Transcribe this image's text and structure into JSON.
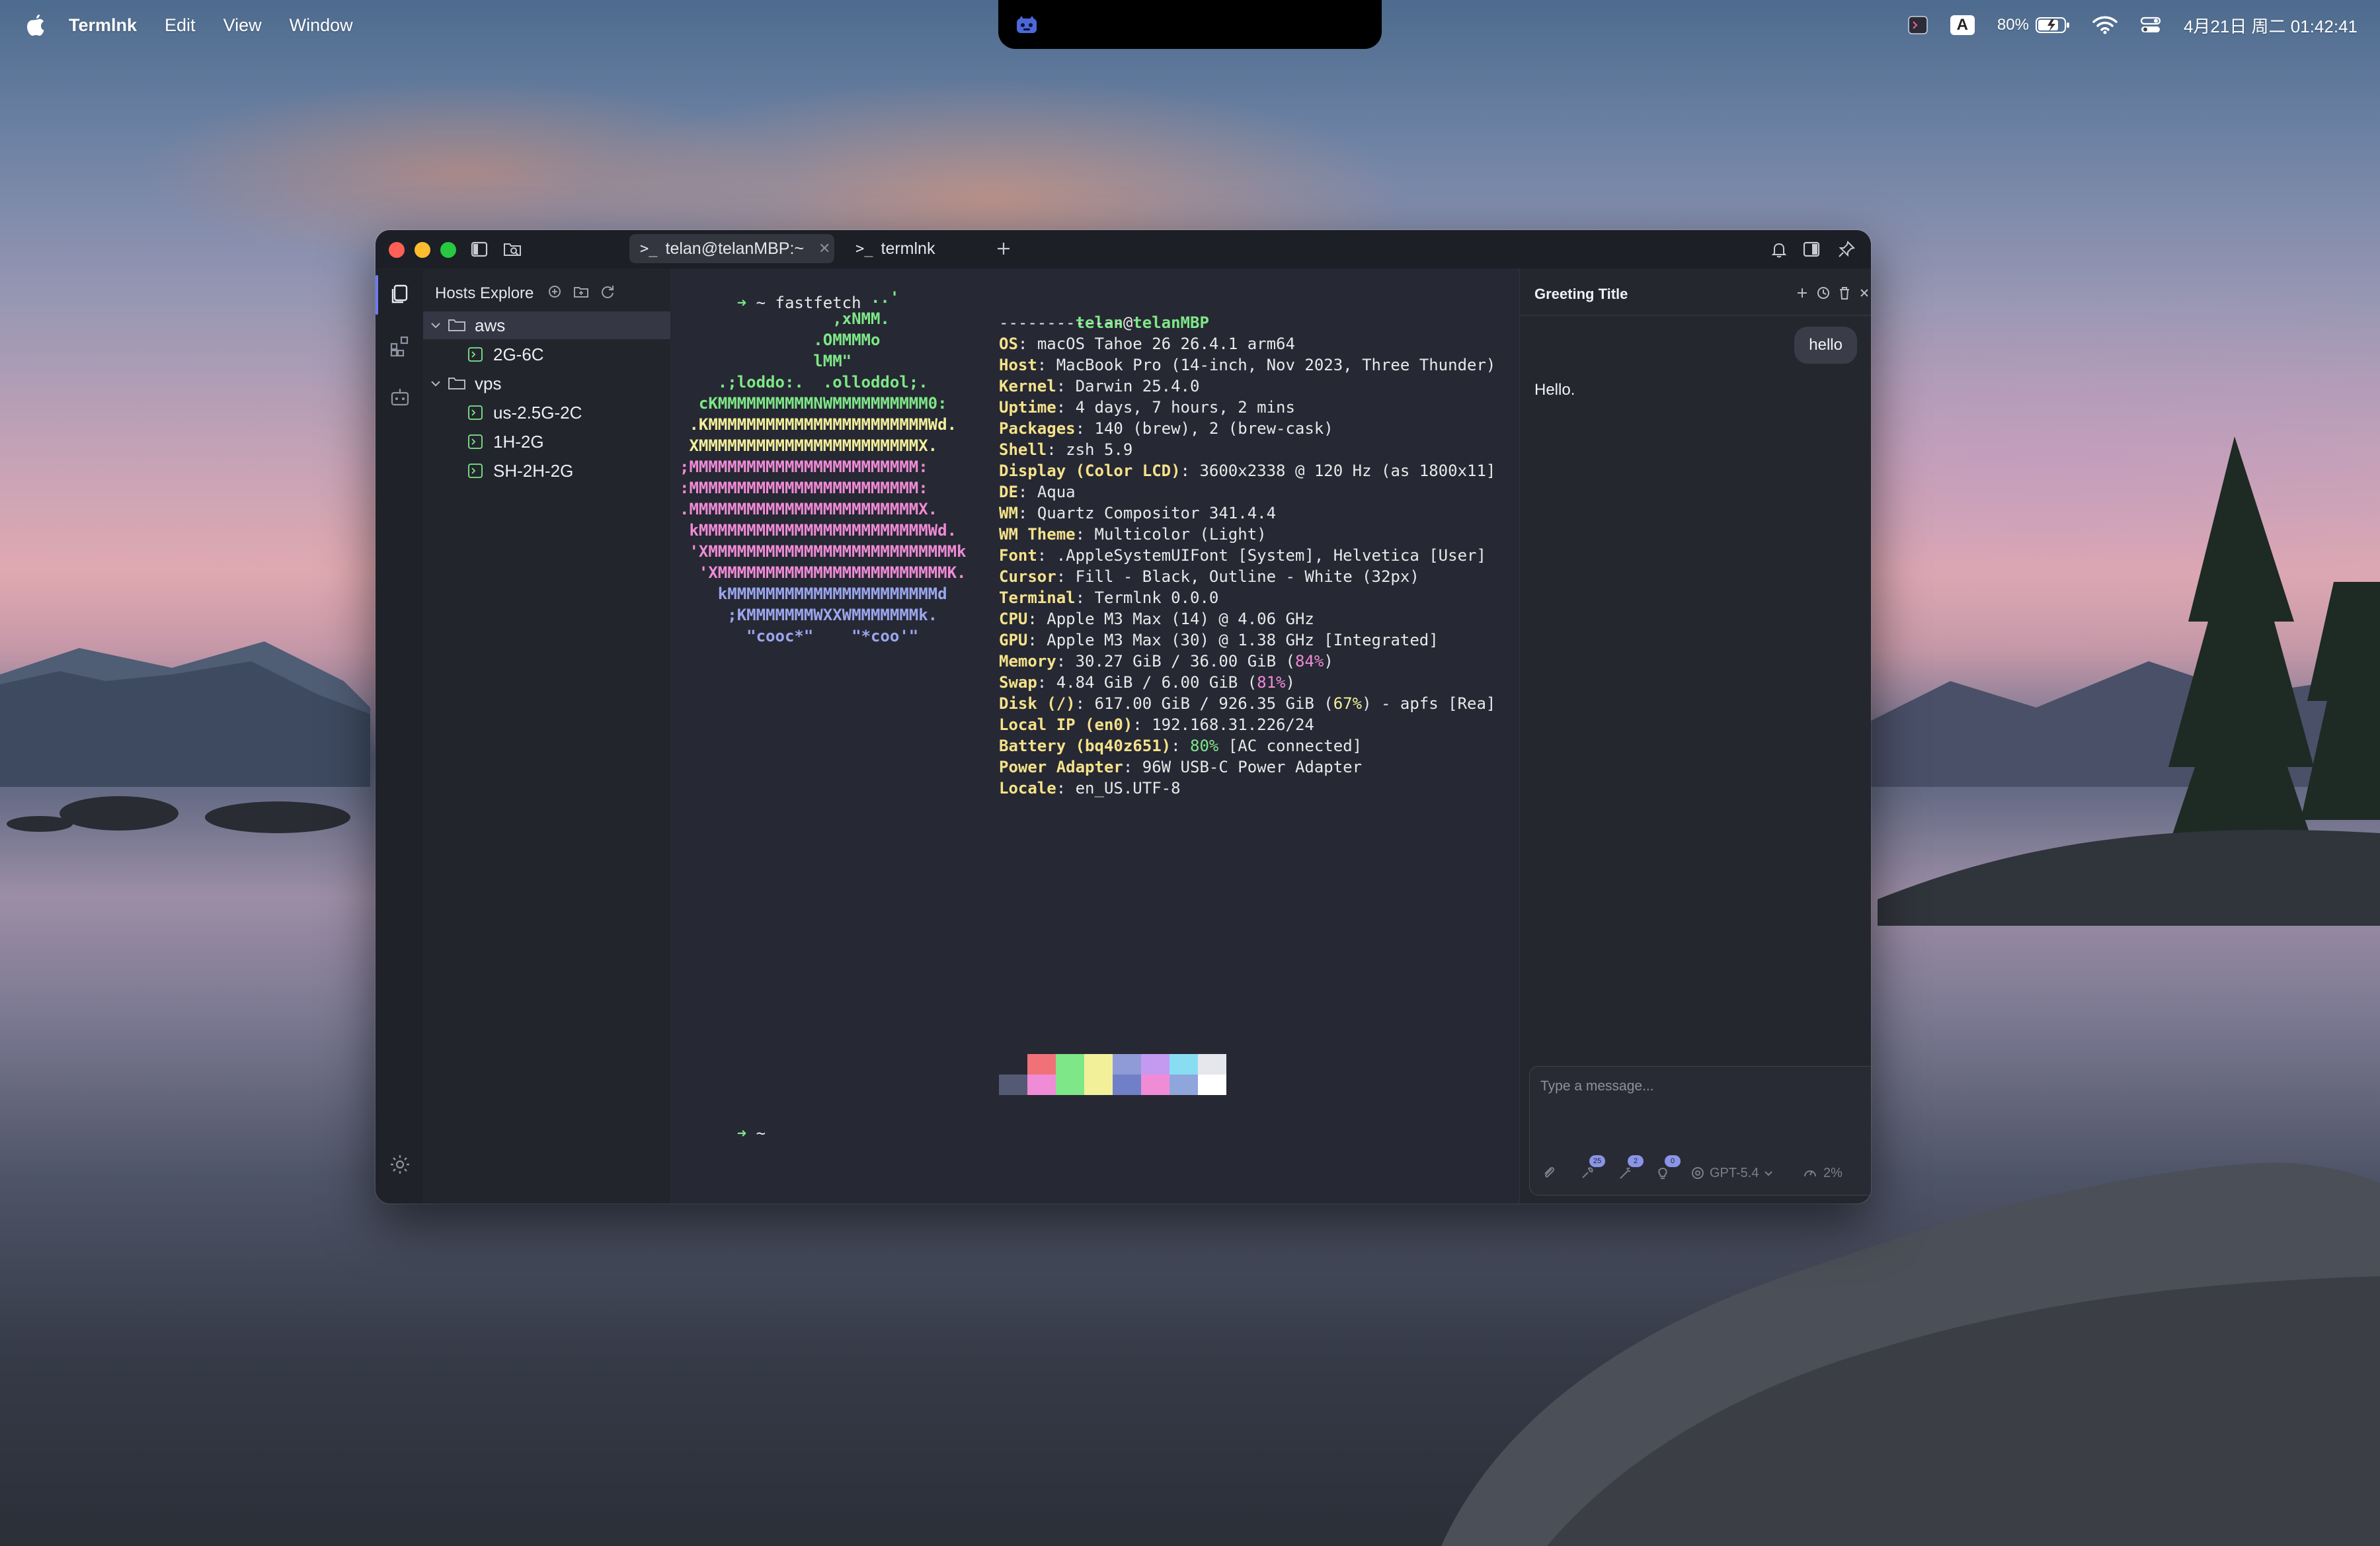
{
  "menubar": {
    "app_name": "Termlnk",
    "items": [
      "Edit",
      "View",
      "Window"
    ],
    "input_source": "A",
    "battery": "80%",
    "datetime": "4月21日 周二  01:42:41"
  },
  "tabs": [
    {
      "label": "telan@telanMBP:~",
      "active": true
    },
    {
      "label": "termlnk",
      "active": false
    }
  ],
  "explorer": {
    "title": "Hosts Explore",
    "folders": [
      {
        "name": "aws",
        "hosts": [
          "2G-6C"
        ]
      },
      {
        "name": "vps",
        "hosts": [
          "us-2.5G-2C",
          "1H-2G",
          "SH-2H-2G"
        ]
      }
    ]
  },
  "terminal": {
    "prompt_symbol": "➜",
    "command_line": "~ fastfetch",
    "prompt_line": "~",
    "logo": [
      {
        "text": "                    ..'",
        "color": "#7ee787"
      },
      {
        "text": "                ,xNMM.",
        "color": "#7ee787"
      },
      {
        "text": "              .OMMMMo",
        "color": "#7ee787"
      },
      {
        "text": "              lMM\"",
        "color": "#7ee787"
      },
      {
        "text": "    .;loddo:.  .olloddol;.",
        "color": "#7ee787"
      },
      {
        "text": "  cKMMMMMMMMMMNWMMMMMMMMMM0:",
        "color": "#7ee787"
      },
      {
        "text": " .KMMMMMMMMMMMMMMMMMMMMMMMWd.",
        "color": "#f3f09a"
      },
      {
        "text": " XMMMMMMMMMMMMMMMMMMMMMMMX.",
        "color": "#f3f09a"
      },
      {
        "text": ";MMMMMMMMMMMMMMMMMMMMMMMM:",
        "color": "#f08bd6"
      },
      {
        "text": ":MMMMMMMMMMMMMMMMMMMMMMMM:",
        "color": "#f08bd6"
      },
      {
        "text": ".MMMMMMMMMMMMMMMMMMMMMMMMX.",
        "color": "#f08bd6"
      },
      {
        "text": " kMMMMMMMMMMMMMMMMMMMMMMMMWd.",
        "color": "#f08bd6"
      },
      {
        "text": " 'XMMMMMMMMMMMMMMMMMMMMMMMMMMk",
        "color": "#f08bd6"
      },
      {
        "text": "  'XMMMMMMMMMMMMMMMMMMMMMMMMK.",
        "color": "#f08bd6"
      },
      {
        "text": "    kMMMMMMMMMMMMMMMMMMMMMMd",
        "color": "#9aa6ee"
      },
      {
        "text": "     ;KMMMMMMMWXXWMMMMMMMk.",
        "color": "#9aa6ee"
      },
      {
        "text": "       \"cooc*\"    \"*coo'\"",
        "color": "#9aa6ee"
      }
    ],
    "user": "telan",
    "at": "@",
    "host": "telanMBP",
    "separator": "-------------",
    "info": [
      {
        "key": "OS",
        "parts": [
          {
            "t": "macOS Tahoe 26 26.4.1 arm64"
          }
        ]
      },
      {
        "key": "Host",
        "parts": [
          {
            "t": "MacBook Pro (14-inch, Nov 2023, Three Thunder)"
          }
        ]
      },
      {
        "key": "Kernel",
        "parts": [
          {
            "t": "Darwin 25.4.0"
          }
        ]
      },
      {
        "key": "Uptime",
        "parts": [
          {
            "t": "4 days, 7 hours, 2 mins"
          }
        ]
      },
      {
        "key": "Packages",
        "parts": [
          {
            "t": "140 (brew), 2 (brew-cask)"
          }
        ]
      },
      {
        "key": "Shell",
        "parts": [
          {
            "t": "zsh 5.9"
          }
        ]
      },
      {
        "key": "Display (Color LCD)",
        "parts": [
          {
            "t": "3600x2338 @ 120 Hz (as 1800x11]"
          }
        ]
      },
      {
        "key": "DE",
        "parts": [
          {
            "t": "Aqua"
          }
        ]
      },
      {
        "key": "WM",
        "parts": [
          {
            "t": "Quartz Compositor 341.4.4"
          }
        ]
      },
      {
        "key": "WM Theme",
        "parts": [
          {
            "t": "Multicolor (Light)"
          }
        ]
      },
      {
        "key": "Font",
        "parts": [
          {
            "t": ".AppleSystemUIFont [System], Helvetica [User]"
          }
        ]
      },
      {
        "key": "Cursor",
        "parts": [
          {
            "t": "Fill - Black, Outline - White (32px)"
          }
        ]
      },
      {
        "key": "Terminal",
        "parts": [
          {
            "t": "Termlnk 0.0.0"
          }
        ]
      },
      {
        "key": "CPU",
        "parts": [
          {
            "t": "Apple M3 Max (14) @ 4.06 GHz"
          }
        ]
      },
      {
        "key": "GPU",
        "parts": [
          {
            "t": "Apple M3 Max (30) @ 1.38 GHz [Integrated]"
          }
        ]
      },
      {
        "key": "Memory",
        "parts": [
          {
            "t": "30.27 GiB / 36.00 GiB ("
          },
          {
            "t": "84%",
            "c": "#f08bd6"
          },
          {
            "t": ")"
          }
        ]
      },
      {
        "key": "Swap",
        "parts": [
          {
            "t": "4.84 GiB / 6.00 GiB ("
          },
          {
            "t": "81%",
            "c": "#f08bd6"
          },
          {
            "t": ")"
          }
        ]
      },
      {
        "key": "Disk (/)",
        "parts": [
          {
            "t": "617.00 GiB / 926.35 GiB ("
          },
          {
            "t": "67%",
            "c": "#f3f09a"
          },
          {
            "t": ") - apfs [Rea]"
          }
        ]
      },
      {
        "key": "Local IP (en0)",
        "parts": [
          {
            "t": "192.168.31.226/24"
          }
        ]
      },
      {
        "key": "Battery (bq40z651)",
        "parts": [
          {
            "t": "80%",
            "c": "#7ee787"
          },
          {
            "t": " [AC connected]"
          }
        ]
      },
      {
        "key": "Power Adapter",
        "parts": [
          {
            "t": "96W USB-C Power Adapter"
          }
        ]
      },
      {
        "key": "Locale",
        "parts": [
          {
            "t": "en_US.UTF-8"
          }
        ]
      }
    ],
    "palette_top": [
      "#262833",
      "#f07178",
      "#7ee787",
      "#f3f09a",
      "#8f9bd6",
      "#c39af0",
      "#89ddf3",
      "#e6e7ec"
    ],
    "palette_bottom": [
      "#555a74",
      "#f08bd6",
      "#7ee787",
      "#f3f09a",
      "#6f80c8",
      "#f08bd6",
      "#8fa6dc",
      "#ffffff"
    ]
  },
  "chat": {
    "title": "Greeting Title",
    "user_message": "hello",
    "assistant_message": "Hello.",
    "placeholder": "Type a message...",
    "badges": [
      "25",
      "2",
      "0"
    ],
    "model": "GPT-5.4",
    "context_usage": "2%"
  },
  "colors": {
    "accent": "#6e7cf0",
    "prompt_green": "#7ee787",
    "key_yellow": "#f5e28a",
    "close_red": "#fe5f57",
    "minimize_yellow": "#febc2e",
    "zoom_green": "#28c840"
  }
}
